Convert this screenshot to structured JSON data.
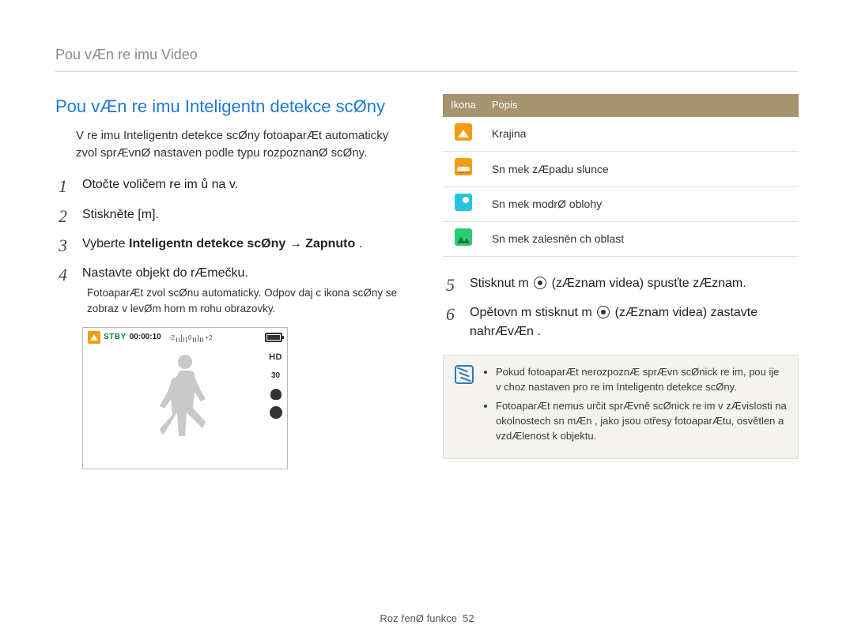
{
  "breadcrumb": "Pou  vÆn  re imu Video",
  "left": {
    "heading": "Pou  vÆn  re imu Inteligentn  detekce scØny",
    "intro": "V re imu Inteligentn  detekce scØny fotoaparÆt automaticky zvol  sprÆvnØ nastaven  podle typu rozpoznanØ scØny.",
    "steps": [
      {
        "text_pre": "Otočte voličem re im ů na v",
        "text_post": "."
      },
      {
        "text_pre": "Stiskněte [m",
        "text_post": "]."
      },
      {
        "text_pre": "Vyberte ",
        "bold": "Inteligentn  detekce scØny",
        "arrow": "  → ",
        "bold2": "Zapnuto",
        "text_post": " ."
      },
      {
        "text_pre": "Nastavte objekt do rÆmečku.",
        "note": "FotoaparÆt zvol  scØnu automaticky. Odpov daj c  ikona scØny se zobraz  v levØm horn m rohu obrazovky."
      }
    ],
    "lcd": {
      "stby": "STBY",
      "timecode": "00:00:10",
      "ev_labels": [
        "-2",
        "0",
        "+2"
      ],
      "hd": "HD",
      "fps": "30"
    }
  },
  "right": {
    "table": {
      "headers": [
        "Ikona",
        "Popis"
      ],
      "rows": [
        {
          "icon": "orange",
          "label": "Krajina"
        },
        {
          "icon": "orange2",
          "label": "Sn mek zÆpadu slunce"
        },
        {
          "icon": "cyan",
          "label": "Sn mek modrØ oblohy"
        },
        {
          "icon": "green",
          "label": "Sn mek zalesněn ch oblast "
        }
      ]
    },
    "steps2": [
      {
        "pre": "Stisknut m ",
        "post1": " (zÆznam videa) spusťte zÆznam."
      },
      {
        "pre": "Opětovn m stisknut m  ",
        "post1": " (zÆznam videa) zastavte nahrÆvÆn ."
      }
    ],
    "info": [
      "Pokud fotoaparÆt nerozpoznÆ sprÆvn  scØnick  re im, pou ije v choz  nastaven  pro re im Inteligentn  detekce scØny.",
      "FotoaparÆt nemus  určit sprÆvně scØnick  re im v zÆvislosti na okolnostech sn mÆn , jako jsou otřesy fotoaparÆtu, osvětlen  a vzdÆlenost k objektu."
    ]
  },
  "footer": {
    "label": "Roz  řenØ funkce",
    "page": "52"
  }
}
